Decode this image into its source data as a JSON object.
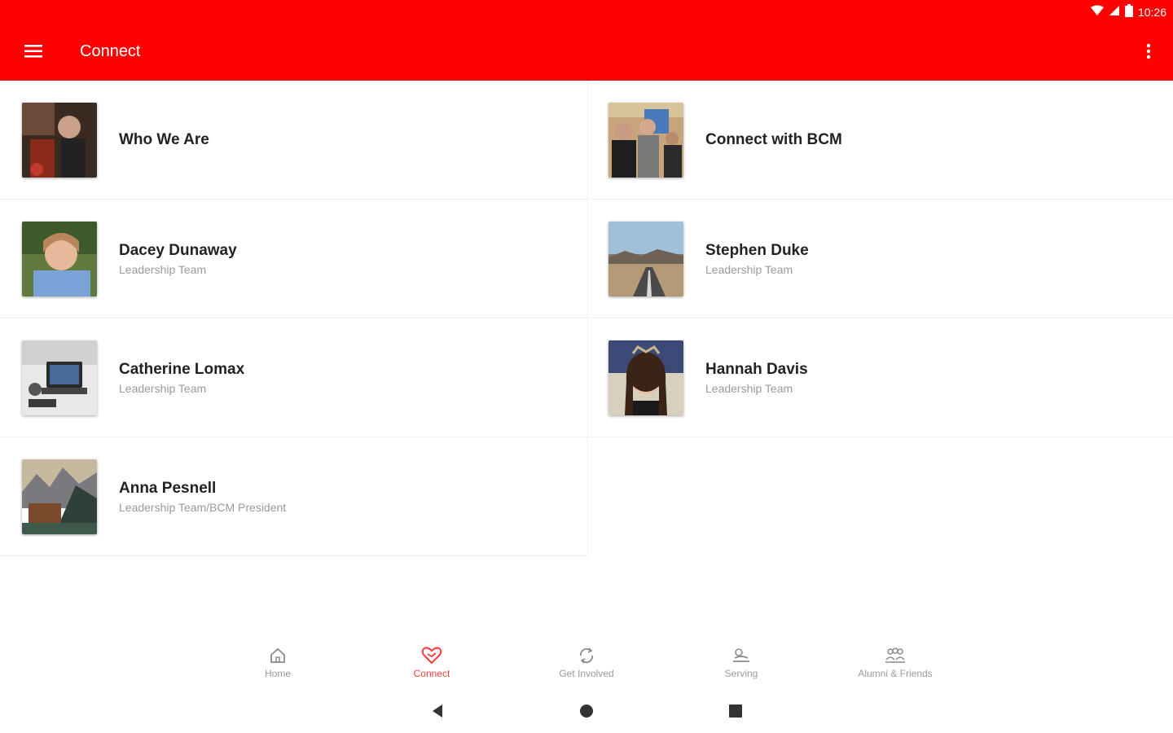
{
  "status_bar": {
    "time": "10:26"
  },
  "app_bar": {
    "title": "Connect"
  },
  "items": [
    {
      "name": "Who We Are",
      "subtitle": ""
    },
    {
      "name": "Connect with BCM",
      "subtitle": ""
    },
    {
      "name": "Dacey Dunaway",
      "subtitle": "Leadership Team"
    },
    {
      "name": "Stephen Duke",
      "subtitle": "Leadership Team"
    },
    {
      "name": "Catherine Lomax",
      "subtitle": "Leadership Team"
    },
    {
      "name": "Hannah Davis",
      "subtitle": "Leadership Team"
    },
    {
      "name": "Anna Pesnell",
      "subtitle": "Leadership Team/BCM President"
    }
  ],
  "bottom_nav": {
    "items": [
      {
        "label": "Home",
        "icon": "home-icon"
      },
      {
        "label": "Connect",
        "icon": "heart-handshake-icon"
      },
      {
        "label": "Get Involved",
        "icon": "refresh-icon"
      },
      {
        "label": "Serving",
        "icon": "serving-hand-icon"
      },
      {
        "label": "Alumni & Friends",
        "icon": "group-icon"
      }
    ],
    "active_index": 1
  },
  "colors": {
    "primary": "#ff0000",
    "active": "#ff3b3b",
    "inactive": "#9a9a9a"
  }
}
